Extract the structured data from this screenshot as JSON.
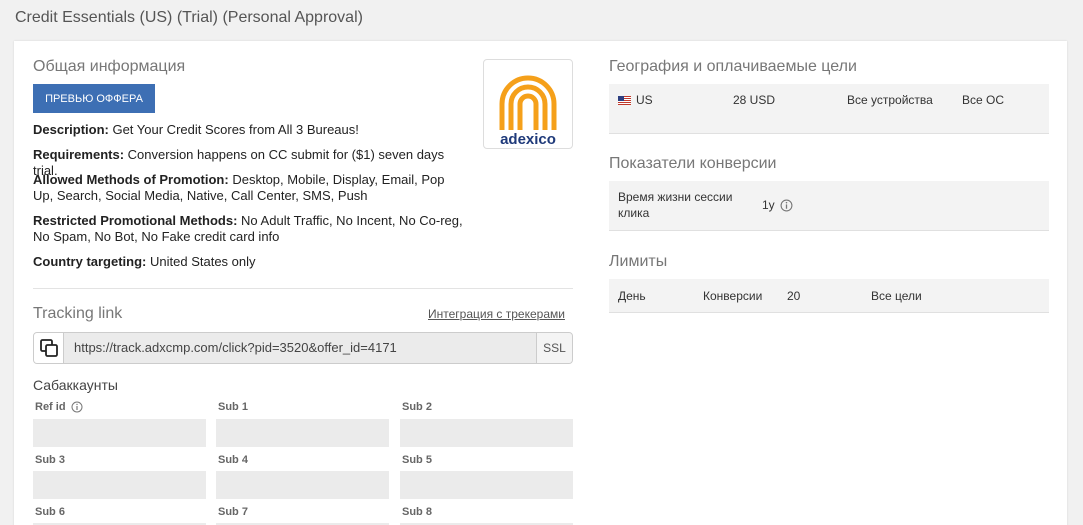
{
  "page": {
    "title": "Credit Essentials (US) (Trial) (Personal Approval)"
  },
  "general": {
    "title": "Общая информация",
    "preview_button": "ПРЕВЬЮ ОФФЕРА",
    "description_label": "Description:",
    "description_value": "Get Your Credit Scores from All 3 Bureaus!",
    "requirements_label": "Requirements:",
    "requirements_value": "Conversion happens on CC submit for ($1) seven days trial.",
    "allowed_label": "Allowed Methods of Promotion:",
    "allowed_value": "Desktop, Mobile, Display, Email, Pop Up, Search, Social Media, Native, Call Center, SMS, Push",
    "restricted_label": "Restricted Promotional Methods:",
    "restricted_value": "No Adult Traffic, No Incent, No Co-reg, No Spam, No Bot, No Fake credit card info",
    "country_label": "Country targeting:",
    "country_value": "United States only",
    "logo_text": "adexico"
  },
  "tracking": {
    "title": "Tracking link",
    "integration_link": "Интеграция с трекерами",
    "url": "https://track.adxcmp.com/click?pid=3520&offer_id=4171",
    "ssl_label": "SSL"
  },
  "subaccounts": {
    "title": "Сабаккаунты",
    "fields": [
      "Ref id",
      "Sub 1",
      "Sub 2",
      "Sub 3",
      "Sub 4",
      "Sub 5",
      "Sub 6",
      "Sub 7",
      "Sub 8"
    ]
  },
  "geo": {
    "title": "География и оплачиваемые цели",
    "row": {
      "country": "US",
      "payout": "28 USD",
      "devices": "Все устройства",
      "os": "Все ОС"
    }
  },
  "conversion": {
    "title": "Показатели конверсии",
    "row": {
      "label": "Время жизни сессии клика",
      "value": "1y"
    }
  },
  "limits": {
    "title": "Лимиты",
    "row": {
      "period": "День",
      "type": "Конверсии",
      "value": "20",
      "goals": "Все цели"
    }
  },
  "colors": {
    "accent": "#3d6fb4",
    "logo_orange": "#f5a01a",
    "logo_blue": "#1f3a7a"
  }
}
